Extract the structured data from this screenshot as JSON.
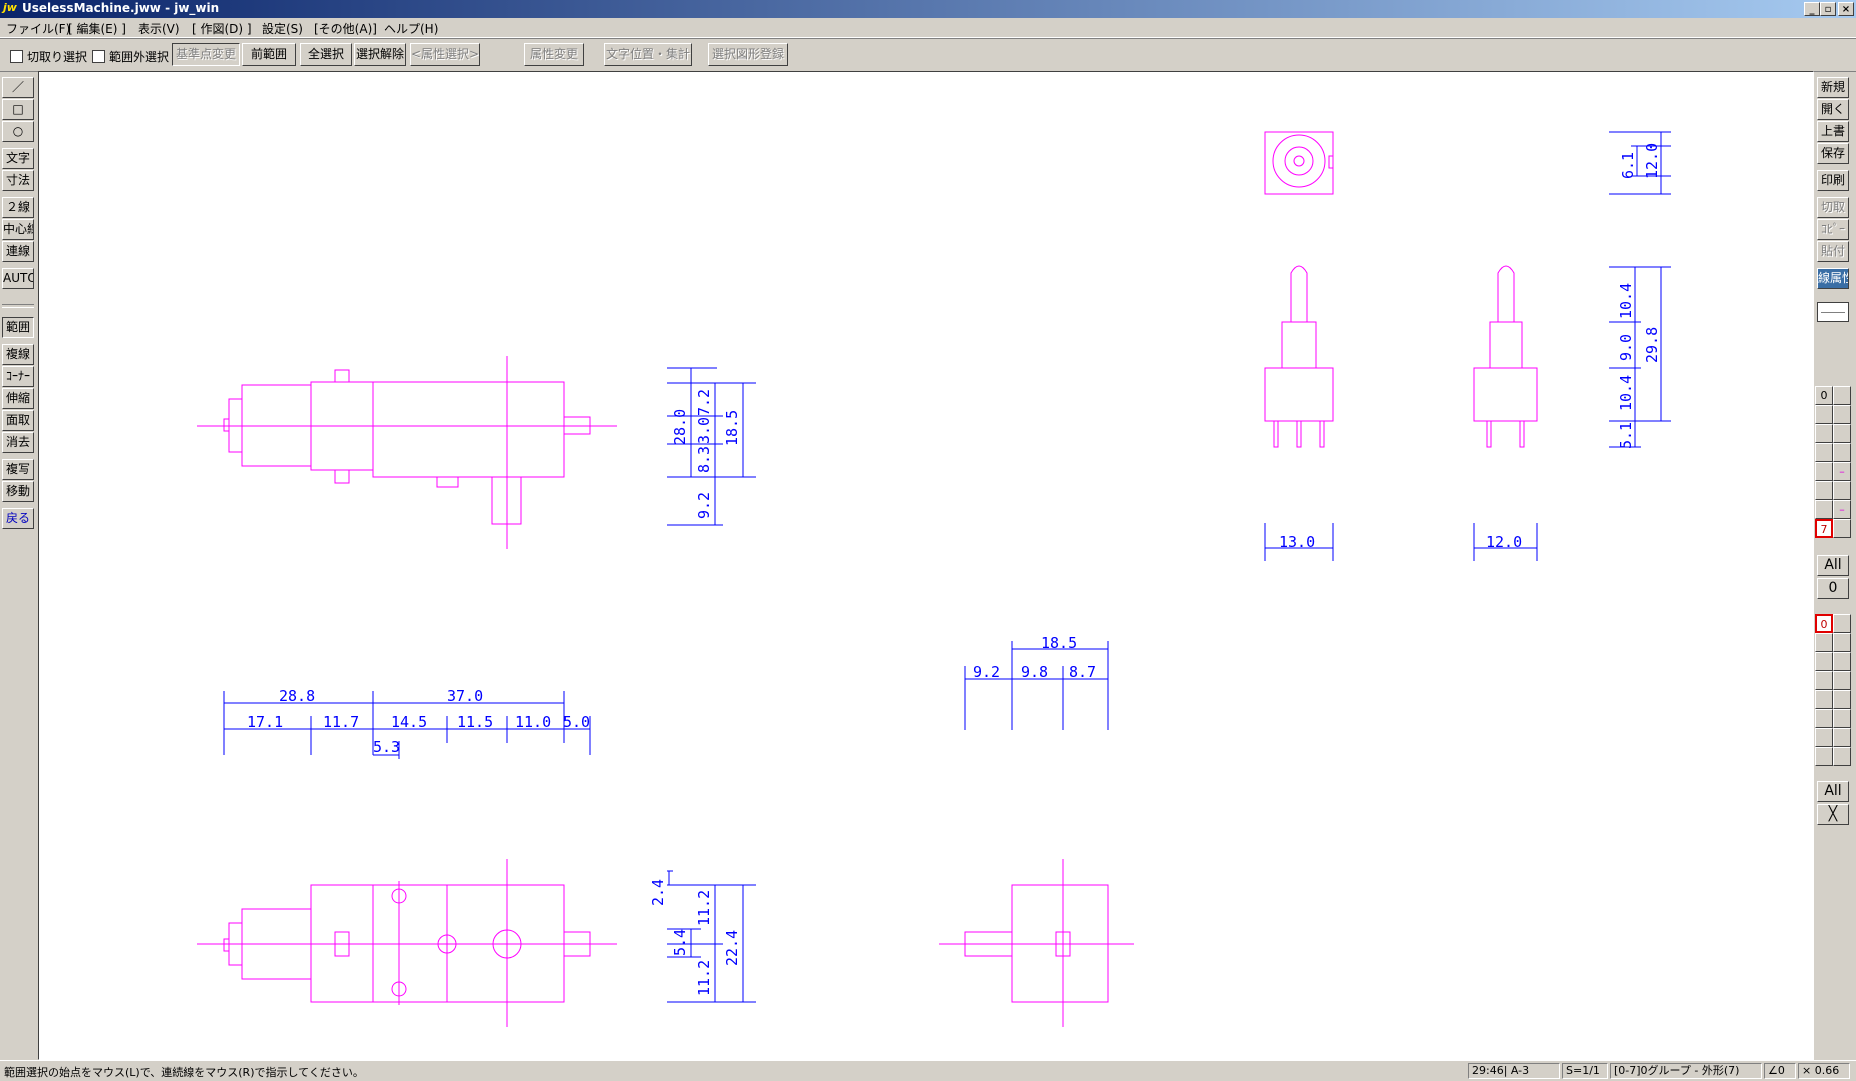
{
  "window": {
    "icon_label": "jw",
    "title": "UselessMachine.jww - jw_win",
    "minimize": "_",
    "maximize": "▫",
    "close": "×"
  },
  "menu": [
    "ファイル(F)",
    "[ 編集(E) ]",
    "表示(V)",
    "[ 作図(D) ]",
    "設定(S)",
    "[その他(A)]",
    "ヘルプ(H)"
  ],
  "toolbar": {
    "check_cut": "切取り選択",
    "check_outside": "範囲外選択",
    "btn_base": "基準点変更",
    "btn_prev": "前範囲",
    "btn_all": "全選択",
    "btn_clear": "選択解除",
    "btn_attr_select": "<属性選択>",
    "btn_attr_change": "属性変更",
    "btn_text_pos": "文字位置・集計",
    "btn_register": "選択図形登録"
  },
  "left_tools": {
    "line": "／",
    "rect": "□",
    "circle": "○",
    "text": "文字",
    "dim": "寸法",
    "double_line": "２線",
    "center_line": "中心線",
    "connect": "連線",
    "auto": "AUTO",
    "range": "範囲",
    "multi_line": "複線",
    "corner": "ｺｰﾅｰ",
    "stretch": "伸縮",
    "chamfer": "面取",
    "erase": "消去",
    "copy": "複写",
    "move": "移動",
    "undo": "戻る"
  },
  "right_tools": {
    "new": "新規",
    "open": "開く",
    "overwrite": "上書",
    "save": "保存",
    "print": "印刷",
    "cut": "切取",
    "copy": "ｺﾋﾟｰ",
    "paste": "貼付",
    "line_attr": "線属性",
    "layer_group_head": "0",
    "layer_group_sel": "7",
    "all_label": "All",
    "zero_label": "0",
    "layer_head": "0",
    "all_label2": "All",
    "cross_label": "╳"
  },
  "dimensions": {
    "front": [
      "28.0",
      "7.2",
      "8.3",
      "3.0",
      "18.5",
      "9.2"
    ],
    "side": [
      "6.1",
      "12.0"
    ],
    "switch_vert": [
      "10.4",
      "9.0",
      "29.8",
      "10.4",
      "5.1"
    ],
    "switch_width": [
      "13.0",
      "12.0"
    ],
    "length_top": [
      "28.8",
      "37.0"
    ],
    "length_sub": [
      "17.1",
      "11.7",
      "14.5",
      "11.5",
      "11.0",
      "5.0"
    ],
    "length_small": "5.3",
    "mid_top": "18.5",
    "mid_sub": [
      "9.2",
      "9.8",
      "8.7"
    ],
    "bottom_vert": [
      "2.4",
      "11.2",
      "5.4",
      "22.4",
      "11.2"
    ]
  },
  "status": {
    "message": "範囲選択の始点をマウス(L)で、連続線をマウス(R)で指示してください。",
    "paper": "29:46| A-3",
    "scale": "S=1/1",
    "layer": "[0-7]0グループ - 外形(7)",
    "angle": "∠0",
    "zoom": "× 0.66"
  }
}
